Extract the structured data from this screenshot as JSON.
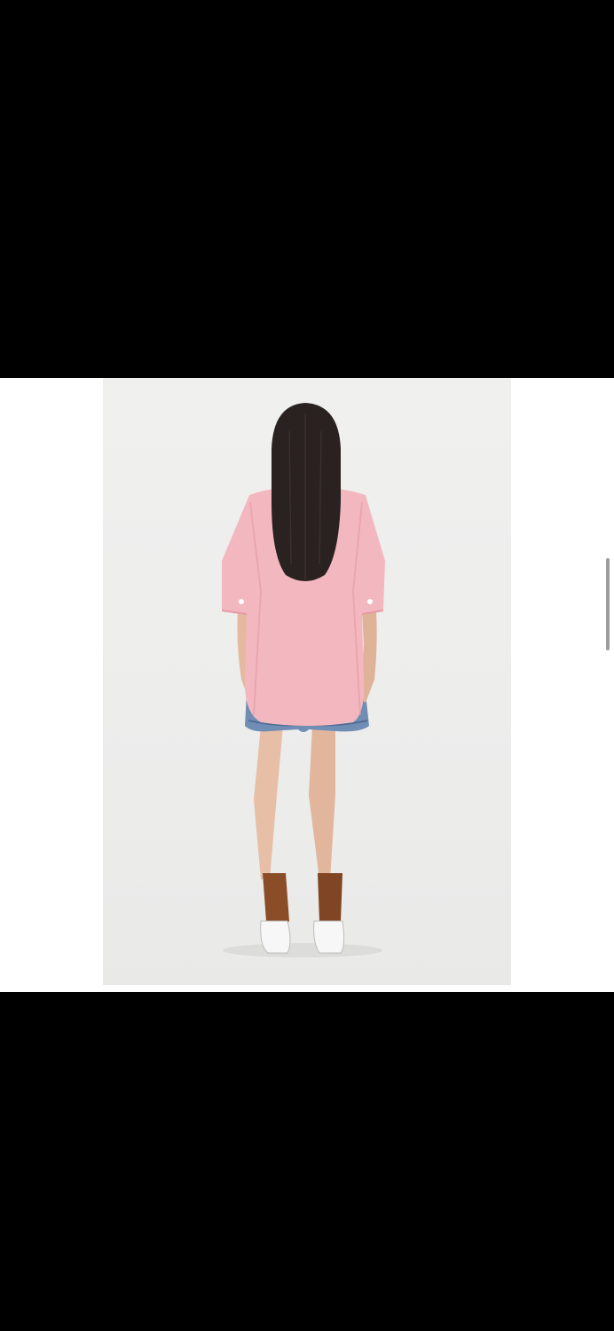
{
  "viewer": {
    "image_subject": "model-back-view",
    "colors": {
      "letterbox": "#000000",
      "content_background": "#ffffff",
      "photo_background": "#eeeeed",
      "shirt": "#f3b8bf",
      "hair": "#2a2220",
      "denim": "#6f8db5",
      "socks": "#8a4d28",
      "skin": "#e7bea6",
      "scrollbar": "#9e9e9e"
    },
    "icons": [
      "scroll-indicator"
    ]
  }
}
